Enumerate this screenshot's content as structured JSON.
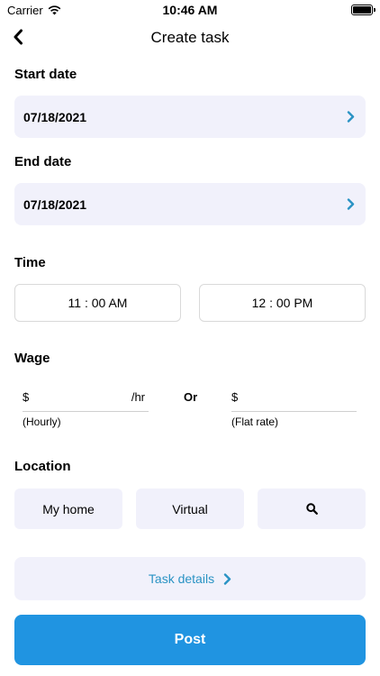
{
  "status_bar": {
    "carrier": "Carrier",
    "time": "10:46 AM"
  },
  "nav": {
    "title": "Create task"
  },
  "start_date": {
    "label": "Start date",
    "value": "07/18/2021"
  },
  "end_date": {
    "label": "End date",
    "value": "07/18/2021"
  },
  "time": {
    "label": "Time",
    "start": "11 : 00 AM",
    "end": "12 : 00 PM"
  },
  "wage": {
    "label": "Wage",
    "hourly": {
      "currency": "$",
      "unit": "/hr",
      "caption": "(Hourly)"
    },
    "or_label": "Or",
    "flat": {
      "currency": "$",
      "caption": "(Flat rate)"
    }
  },
  "location": {
    "label": "Location",
    "options": [
      "My home",
      "Virtual"
    ]
  },
  "task_details": {
    "label": "Task details"
  },
  "post": {
    "label": "Post"
  },
  "colors": {
    "accent": "#2094e1",
    "link": "#2a93c4",
    "field_bg": "#f1f1fb"
  },
  "icons": [
    "wifi-icon",
    "battery-icon",
    "back-chevron-icon",
    "chevron-right-icon",
    "search-icon"
  ]
}
